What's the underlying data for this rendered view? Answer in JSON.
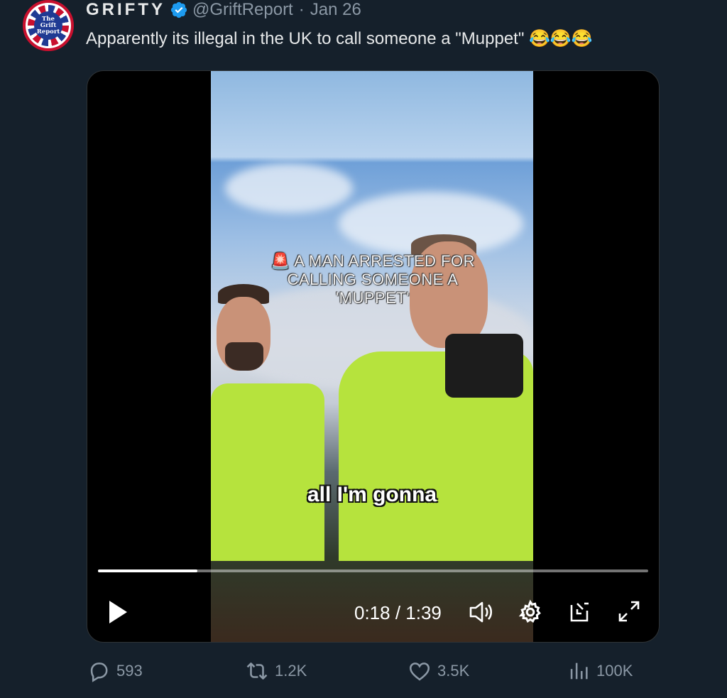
{
  "tweet": {
    "avatar_text": [
      "The",
      "Grift",
      "Report"
    ],
    "display_name": "GRIFTY",
    "handle": "@GriftReport",
    "separator": "·",
    "date": "Jan 26",
    "text": "Apparently its illegal in the UK to call someone a \"Muppet\" 😂😂😂"
  },
  "video": {
    "overlay_title_line1": "🚨 A MAN ARRESTED FOR",
    "overlay_title_line2": "CALLING SOMEONE A",
    "overlay_title_line3": "'MUPPET'",
    "caption": "all I'm gonna",
    "time_display": "0:18 / 1:39",
    "progress_fraction": 0.18,
    "icons": [
      "play-icon",
      "volume-icon",
      "settings-gear-icon",
      "picture-in-picture-icon",
      "fullscreen-icon"
    ]
  },
  "actions": {
    "replies": "593",
    "retweets": "1.2K",
    "likes": "3.5K",
    "views": "100K"
  },
  "colors": {
    "background": "#15202b",
    "verified": "#1d9bf0",
    "muted_text": "#8b98a5",
    "vest": "#b6e33d"
  }
}
